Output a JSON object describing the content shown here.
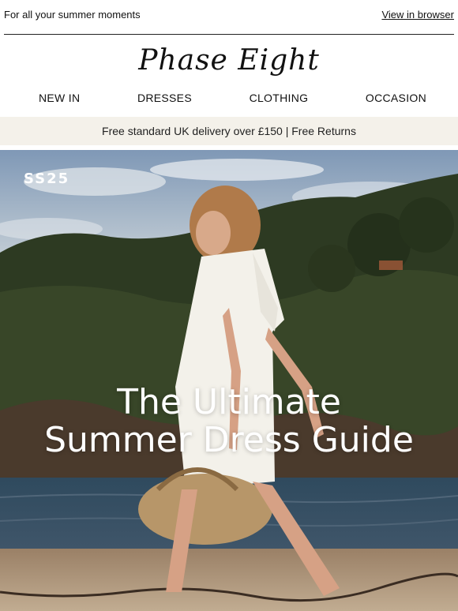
{
  "preheader": {
    "tagline": "For all your summer moments",
    "view_in_browser": "View in browser"
  },
  "brand": {
    "logo": "Phase Eight"
  },
  "nav": {
    "items": [
      {
        "label": "NEW IN"
      },
      {
        "label": "DRESSES"
      },
      {
        "label": "CLOTHING"
      },
      {
        "label": "OCCASION"
      }
    ]
  },
  "banner": {
    "text": "Free standard UK delivery over £150 | Free Returns",
    "background": "#f4f1ea"
  },
  "hero": {
    "badge": "SS25",
    "headline_line1": "The Ultimate",
    "headline_line2": "Summer Dress Guide"
  }
}
